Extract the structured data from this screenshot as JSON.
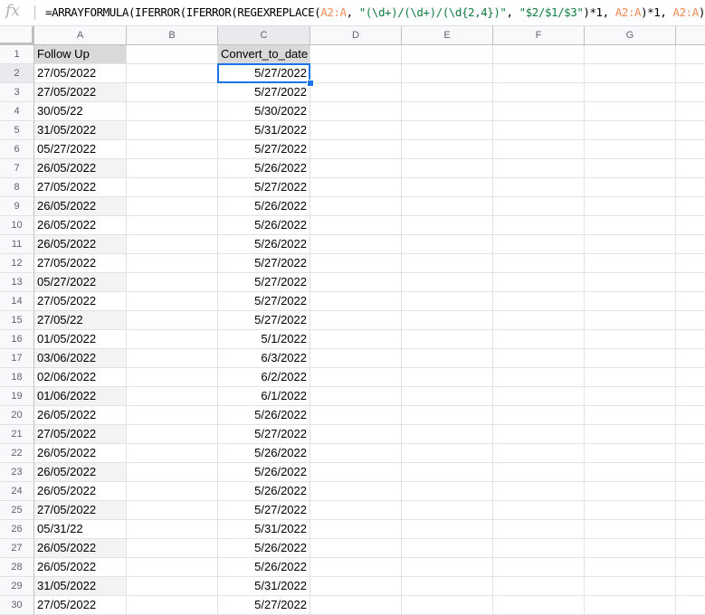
{
  "formula_bar": {
    "fx_label": "fx",
    "formula_parts": [
      {
        "t": "=ARRAYFORMULA(IFERROR(IFERROR(REGEXREPLACE(",
        "k": "plain"
      },
      {
        "t": "A2:A",
        "k": "ref"
      },
      {
        "t": ", ",
        "k": "plain"
      },
      {
        "t": "\"(\\d+)/(\\d+)/(\\d{2,4})\"",
        "k": "str"
      },
      {
        "t": ", ",
        "k": "plain"
      },
      {
        "t": "\"$2/$1/$3\"",
        "k": "str"
      },
      {
        "t": ")*1, ",
        "k": "plain"
      },
      {
        "t": "A2:A",
        "k": "ref"
      },
      {
        "t": ")*1, ",
        "k": "plain"
      },
      {
        "t": "A2:A",
        "k": "ref"
      },
      {
        "t": "))",
        "k": "plain"
      }
    ]
  },
  "columns": [
    "A",
    "B",
    "C",
    "D",
    "E",
    "F",
    "G"
  ],
  "selected_cell": "C2",
  "rows": [
    {
      "n": "1",
      "A": "Follow Up",
      "C": "Convert_to_date"
    },
    {
      "n": "2",
      "A": "27/05/2022",
      "C": "5/27/2022"
    },
    {
      "n": "3",
      "A": "27/05/2022",
      "C": "5/27/2022"
    },
    {
      "n": "4",
      "A": "30/05/22",
      "C": "5/30/2022"
    },
    {
      "n": "5",
      "A": "31/05/2022",
      "C": "5/31/2022"
    },
    {
      "n": "6",
      "A": "05/27/2022",
      "C": "5/27/2022"
    },
    {
      "n": "7",
      "A": "26/05/2022",
      "C": "5/26/2022"
    },
    {
      "n": "8",
      "A": "27/05/2022",
      "C": "5/27/2022"
    },
    {
      "n": "9",
      "A": "26/05/2022",
      "C": "5/26/2022"
    },
    {
      "n": "10",
      "A": "26/05/2022",
      "C": "5/26/2022"
    },
    {
      "n": "11",
      "A": "26/05/2022",
      "C": "5/26/2022"
    },
    {
      "n": "12",
      "A": "27/05/2022",
      "C": "5/27/2022"
    },
    {
      "n": "13",
      "A": "05/27/2022",
      "C": "5/27/2022"
    },
    {
      "n": "14",
      "A": "27/05/2022",
      "C": "5/27/2022"
    },
    {
      "n": "15",
      "A": "27/05/22",
      "C": "5/27/2022"
    },
    {
      "n": "16",
      "A": "01/05/2022",
      "C": "5/1/2022"
    },
    {
      "n": "17",
      "A": "03/06/2022",
      "C": "6/3/2022"
    },
    {
      "n": "18",
      "A": "02/06/2022",
      "C": "6/2/2022"
    },
    {
      "n": "19",
      "A": "01/06/2022",
      "C": "6/1/2022"
    },
    {
      "n": "20",
      "A": "26/05/2022",
      "C": "5/26/2022"
    },
    {
      "n": "21",
      "A": "27/05/2022",
      "C": "5/27/2022"
    },
    {
      "n": "22",
      "A": "26/05/2022",
      "C": "5/26/2022"
    },
    {
      "n": "23",
      "A": "26/05/2022",
      "C": "5/26/2022"
    },
    {
      "n": "24",
      "A": "26/05/2022",
      "C": "5/26/2022"
    },
    {
      "n": "25",
      "A": "27/05/2022",
      "C": "5/27/2022"
    },
    {
      "n": "26",
      "A": "05/31/22",
      "C": "5/31/2022"
    },
    {
      "n": "27",
      "A": "26/05/2022",
      "C": "5/26/2022"
    },
    {
      "n": "28",
      "A": "26/05/2022",
      "C": "5/26/2022"
    },
    {
      "n": "29",
      "A": "31/05/2022",
      "C": "5/31/2022"
    },
    {
      "n": "30",
      "A": "27/05/2022",
      "C": "5/27/2022"
    }
  ],
  "colors": {
    "selection": "#1a73e8",
    "formula_ref": "#f28b50",
    "formula_string": "#0f7d3e"
  }
}
